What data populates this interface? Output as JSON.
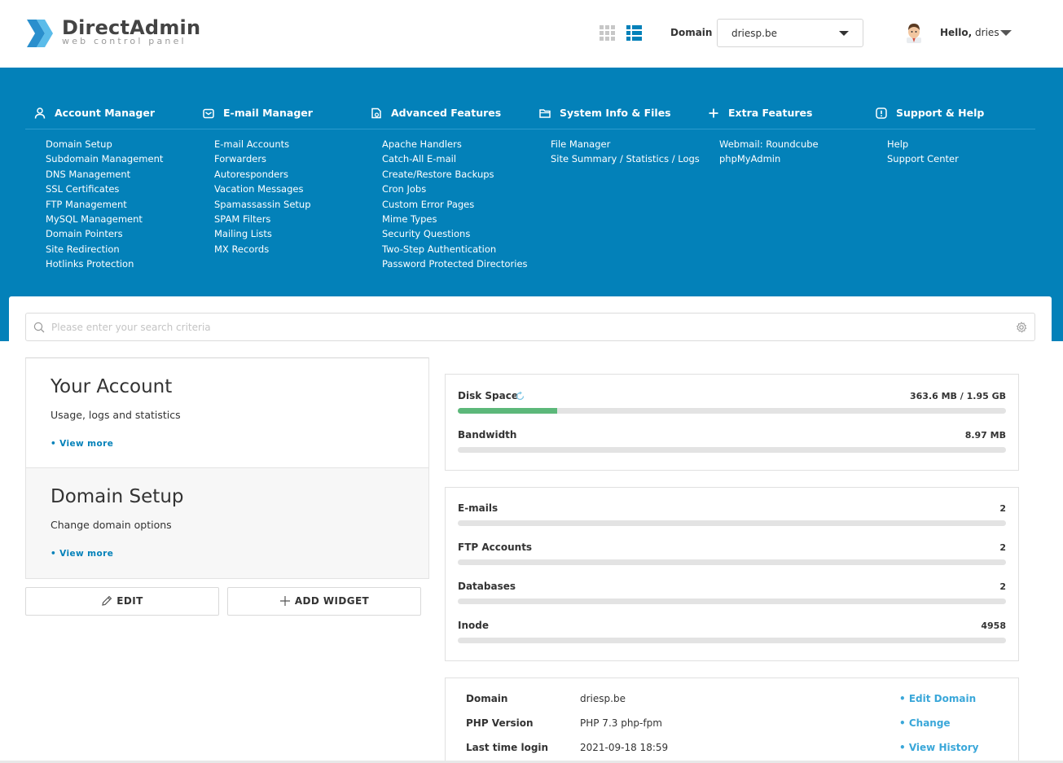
{
  "header": {
    "logo_title": "DirectAdmin",
    "logo_subtitle": "web control panel",
    "domain_label": "Domain",
    "domain_value": "driesp.be",
    "hello_label": "Hello,",
    "username": "dries",
    "icons": [
      "grid-view-icon",
      "list-view-icon",
      "user-avatar",
      "chevron-down-icon"
    ]
  },
  "menu": {
    "columns": [
      {
        "title": "Account Manager",
        "icon": "user-icon",
        "items": [
          "Domain Setup",
          "Subdomain Management",
          "DNS Management",
          "SSL Certificates",
          "FTP Management",
          "MySQL Management",
          "Domain Pointers",
          "Site Redirection",
          "Hotlinks Protection"
        ]
      },
      {
        "title": "E-mail Manager",
        "icon": "mail-icon",
        "items": [
          "E-mail Accounts",
          "Forwarders",
          "Autoresponders",
          "Vacation Messages",
          "Spamassassin Setup",
          "SPAM Filters",
          "Mailing Lists",
          "MX Records"
        ]
      },
      {
        "title": "Advanced Features",
        "icon": "advanced-icon",
        "items": [
          "Apache Handlers",
          "Catch-All E-mail",
          "Create/Restore Backups",
          "Cron Jobs",
          "Custom Error Pages",
          "Mime Types",
          "Security Questions",
          "Two-Step Authentication",
          "Password Protected Directories"
        ]
      },
      {
        "title": "System Info & Files",
        "icon": "folder-icon",
        "items": [
          "File Manager",
          "Site Summary / Statistics / Logs"
        ]
      },
      {
        "title": "Extra Features",
        "icon": "plus-icon",
        "items": [
          "Webmail: Roundcube",
          "phpMyAdmin"
        ]
      },
      {
        "title": "Support & Help",
        "icon": "alert-icon",
        "items": [
          "Help",
          "Support Center"
        ]
      }
    ]
  },
  "search": {
    "placeholder": "Please enter your search criteria",
    "value": ""
  },
  "widgets": [
    {
      "title": "Your Account",
      "description": "Usage, logs and statistics",
      "link": "• View more"
    },
    {
      "title": "Domain Setup",
      "description": "Change domain options",
      "link": "• View more"
    }
  ],
  "buttons": {
    "edit": "EDIT",
    "add_widget": "ADD WIDGET"
  },
  "usage": [
    {
      "label": "Disk Space",
      "value": "363.6 MB / 1.95 GB",
      "fraction": 0.182
    },
    {
      "label": "Bandwidth",
      "value": "8.97 MB",
      "fraction": 0
    }
  ],
  "counts": [
    {
      "label": "E-mails",
      "value": "2",
      "fraction": 0
    },
    {
      "label": "FTP Accounts",
      "value": "2",
      "fraction": 0
    },
    {
      "label": "Databases",
      "value": "2",
      "fraction": 0
    },
    {
      "label": "Inode",
      "value": "4958",
      "fraction": 0
    }
  ],
  "info": [
    {
      "key": "Domain",
      "value": "driesp.be",
      "link": "• Edit Domain"
    },
    {
      "key": "PHP Version",
      "value": "PHP 7.3 php-fpm",
      "link": "• Change"
    },
    {
      "key": "Last time login",
      "value": "2021-09-18 18:59",
      "link": "• View History"
    }
  ],
  "colors": {
    "menu_background": "#0381b9",
    "link_blue": "#3aa7d9",
    "progress_green": "#5cb87a",
    "progress_track": "#e3e3e3"
  }
}
